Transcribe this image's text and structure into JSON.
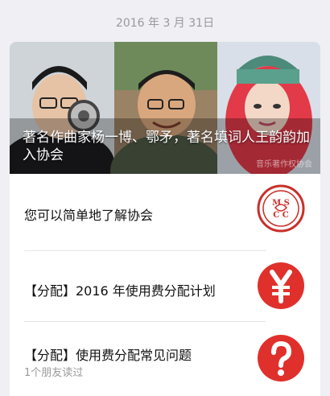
{
  "date": "2016 年 3 月 31日",
  "hero": {
    "title": "著名作曲家杨一博、鄂矛，著名填词人王韵韵加入协会",
    "watermark": "音乐著作权协会"
  },
  "articles": [
    {
      "title": "您可以简单地了解协会",
      "meta": "",
      "icon": "seal-logo-icon"
    },
    {
      "title": "【分配】2016 年使用费分配计划",
      "meta": "",
      "icon": "yuan-icon"
    },
    {
      "title": "【分配】使用费分配常见问题",
      "meta": "1个朋友读过",
      "icon": "question-icon"
    }
  ],
  "colors": {
    "accent_red": "#e0302c",
    "seal_red": "#c8302a"
  }
}
